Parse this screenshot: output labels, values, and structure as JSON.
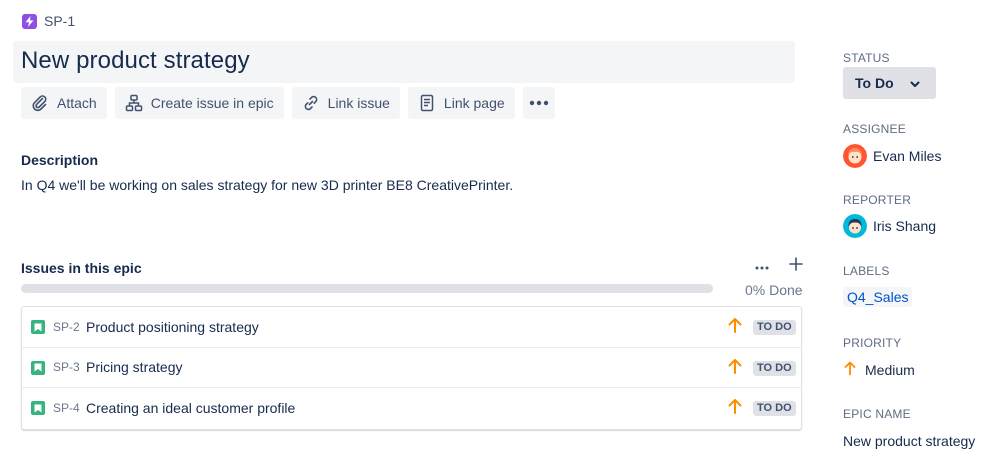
{
  "breadcrumb": {
    "key": "SP-1"
  },
  "title": "New product strategy",
  "toolbar": {
    "attach": "Attach",
    "create_issue": "Create issue in epic",
    "link_issue": "Link issue",
    "link_page": "Link page"
  },
  "description": {
    "label": "Description",
    "text": "In Q4 we'll be working on sales strategy for new 3D printer BE8 CreativePrinter."
  },
  "epic_issues": {
    "label": "Issues in this epic",
    "progress_text": "0% Done",
    "progress_fraction": 0,
    "issues": [
      {
        "key": "SP-2",
        "summary": "Product positioning strategy",
        "status": "TO DO",
        "priority": "high"
      },
      {
        "key": "SP-3",
        "summary": "Pricing strategy",
        "status": "TO DO",
        "priority": "high"
      },
      {
        "key": "SP-4",
        "summary": "Creating an ideal customer profile",
        "status": "TO DO",
        "priority": "high"
      }
    ]
  },
  "sidebar": {
    "status": {
      "label": "STATUS",
      "value": "To Do"
    },
    "assignee": {
      "label": "ASSIGNEE",
      "name": "Evan Miles"
    },
    "reporter": {
      "label": "REPORTER",
      "name": "Iris Shang"
    },
    "labels": {
      "label": "LABELS",
      "values": [
        "Q4_Sales"
      ]
    },
    "priority": {
      "label": "PRIORITY",
      "value": "Medium"
    },
    "epic_name": {
      "label": "EPIC NAME",
      "value": "New product strategy"
    }
  },
  "colors": {
    "epic": "#904ee2",
    "story": "#36b37e",
    "priority_arrow": "#ff8b00",
    "link": "#0052cc"
  }
}
